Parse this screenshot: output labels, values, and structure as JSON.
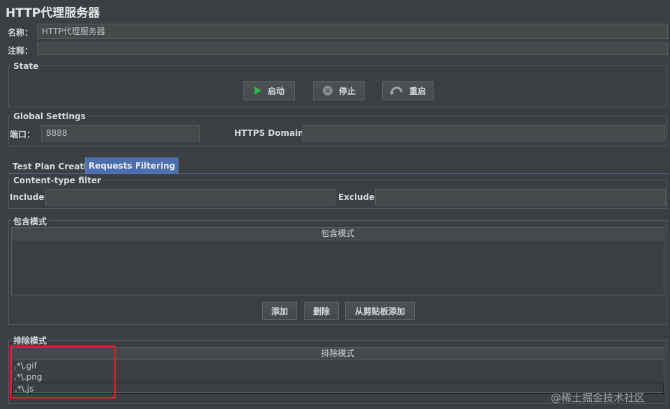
{
  "title": "HTTP代理服务器",
  "name_label": "名称：",
  "name_value": "HTTP代理服务器",
  "comment_label": "注释：",
  "comment_value": "",
  "state": {
    "legend": "State",
    "start_label": "启动",
    "stop_label": "停止",
    "restart_label": "重启"
  },
  "global": {
    "legend": "Global Settings",
    "port_label": "端口：",
    "port_value": "8888",
    "https_label": "HTTPS Domains:",
    "https_value": ""
  },
  "tabs": [
    {
      "label": "Test Plan Creation"
    },
    {
      "label": "Requests Filtering"
    }
  ],
  "content_filter": {
    "legend": "Content-type filter",
    "include_label": "Include:",
    "include_value": "",
    "exclude_label": "Exclude:",
    "exclude_value": ""
  },
  "include_patterns": {
    "legend": "包含模式",
    "column_header": "包含模式",
    "rows": []
  },
  "pattern_buttons": {
    "add": "添加",
    "delete": "删除",
    "paste": "从剪贴板添加"
  },
  "exclude_patterns": {
    "legend": "排除模式",
    "column_header": "排除模式",
    "rows": [
      ".*\\.gif",
      ".*\\.png",
      ".*\\.js"
    ]
  },
  "watermark": "@稀土掘金技术社区",
  "colors": {
    "background": "#3c3f41",
    "active_tab": "#4b6eaf",
    "start_icon": "#2fb84a",
    "highlight_box": "#e02020"
  }
}
